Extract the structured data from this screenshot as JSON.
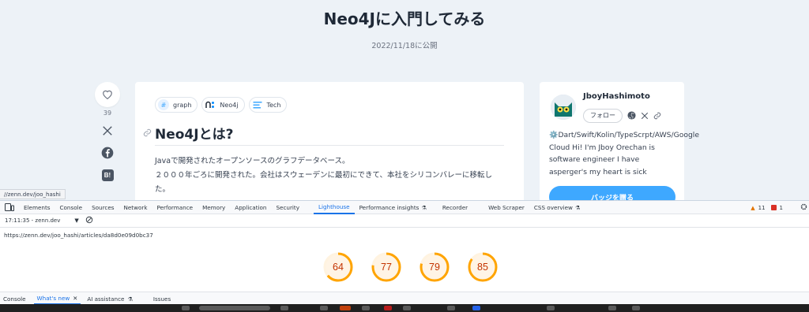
{
  "article": {
    "title": "Neo4Jに入門してみる",
    "published": "2022/11/18に公開",
    "likes": "39",
    "tags": [
      {
        "label": "graph",
        "icon": "hash-icon"
      },
      {
        "label": "Neo4j",
        "icon": "neo4j-logo-icon"
      },
      {
        "label": "Tech",
        "icon": "tech-icon"
      }
    ],
    "heading": "Neo4Jとは?",
    "paragraphs": [
      "Javaで開発されたオープンソースのグラフデータベース。",
      "２０００年ごろに開発された。会社はスウェーデンに最初にできて、本社をシリコンバレーに移転した。"
    ]
  },
  "author": {
    "name": "JboyHashimoto",
    "follow_label": "フォロー",
    "bio": "⚙️Dart/Swift/Kolin/TypeScrpt/AWS/Google Cloud Hi! I'm Jboy Orechan is software engineer I have asperger's my heart is sick",
    "badge_label": "バッジを贈る"
  },
  "url_tooltip": "//zenn.dev/joo_hashi",
  "devtools": {
    "tabs": [
      {
        "label": "Elements"
      },
      {
        "label": "Console"
      },
      {
        "label": "Sources"
      },
      {
        "label": "Network"
      },
      {
        "label": "Performance"
      },
      {
        "label": "Memory"
      },
      {
        "label": "Application"
      },
      {
        "label": "Security"
      },
      {
        "label": "Lighthouse"
      },
      {
        "label": "Performance insights"
      },
      {
        "label": "Recorder"
      },
      {
        "label": "Web Scraper"
      },
      {
        "label": "CSS overview"
      }
    ],
    "active_tab": "Lighthouse",
    "warnings": "11",
    "errors": "1",
    "report_select": "17:11:35 - zenn.dev",
    "report_url": "https://zenn.dev/joo_hashi/articles/da8d0e09d0bc37",
    "scores": [
      {
        "value": "64",
        "fraction": 0.64
      },
      {
        "value": "77",
        "fraction": 0.77
      },
      {
        "value": "79",
        "fraction": 0.79
      },
      {
        "value": "85",
        "fraction": 0.85
      }
    ],
    "score_color": "#ffa400",
    "drawer_tabs": [
      {
        "label": "Console"
      },
      {
        "label": "What's new"
      },
      {
        "label": "AI assistance"
      },
      {
        "label": "Issues"
      }
    ],
    "drawer_active": "What's new"
  },
  "colors": {
    "accent": "#3ea8ff",
    "devtools_active": "#1a73e8",
    "page_bg": "#edf2f7"
  }
}
